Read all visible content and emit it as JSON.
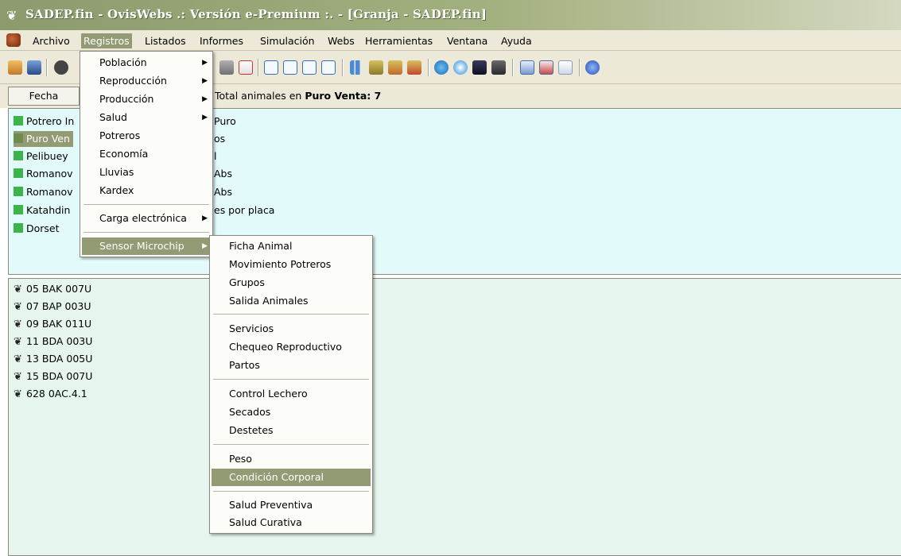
{
  "window": {
    "title": "SADEP.fin - OvisWebs .: Versión e-Premium :. - [Granja - SADEP.fin]"
  },
  "menubar": {
    "items": [
      "Archivo",
      "Registros",
      "Listados",
      "Informes",
      "Simulación",
      "Webs",
      "Herramientas",
      "Ventana",
      "Ayuda"
    ],
    "active": "Registros"
  },
  "infobar": {
    "fecha_button": "Fecha",
    "total_label": "Total animales en",
    "group_name": "Puro Venta: 7"
  },
  "groups": [
    {
      "name": "Potrero In",
      "desc": "Puro"
    },
    {
      "name": "Puro Ven",
      "desc": "os",
      "selected": true
    },
    {
      "name": "Pelibuey",
      "desc": "l"
    },
    {
      "name": "Romanov",
      "desc": "Abs"
    },
    {
      "name": "Romanov",
      "desc": "Abs"
    },
    {
      "name": "Katahdin",
      "desc": "es por placa"
    },
    {
      "name": "Dorset",
      "desc": ""
    }
  ],
  "animals": [
    "05 BAK 007U",
    "07 BAP 003U",
    "09 BAK 011U",
    "11 BDA 003U",
    "13 BDA 005U",
    "15 BDA 007U",
    "628 0AC.4.1"
  ],
  "registros_menu": {
    "items": [
      "Población",
      "Reproducción",
      "Producción",
      "Salud",
      "Potreros",
      "Economía",
      "Lluvias",
      "Kardex",
      "Carga electrónica",
      "Sensor Microchip"
    ],
    "highlighted": "Sensor Microchip"
  },
  "sensor_submenu": {
    "items": [
      "Ficha Animal",
      "Movimiento Potreros",
      "Grupos",
      "Salida Animales",
      "Servicios",
      "Chequeo Reproductivo",
      "Partos",
      "Control Lechero",
      "Secados",
      "Destetes",
      "Peso",
      "Condición Corporal",
      "Salud Preventiva",
      "Salud Curativa"
    ],
    "highlighted": "Condición Corporal"
  },
  "colors": {
    "title_bar": "#a3b07f",
    "highlight": "#939b74",
    "menu_bg": "#ece9d8",
    "panel_top": "#e3fafa",
    "panel_bottom": "#e6f6ee",
    "group_square": "#3cb44b"
  },
  "icons": [
    "app-sheep-icon",
    "open-folder-icon",
    "save-icon",
    "help-icon",
    "bar-chart-icon",
    "browser-icon",
    "camera-icon"
  ]
}
